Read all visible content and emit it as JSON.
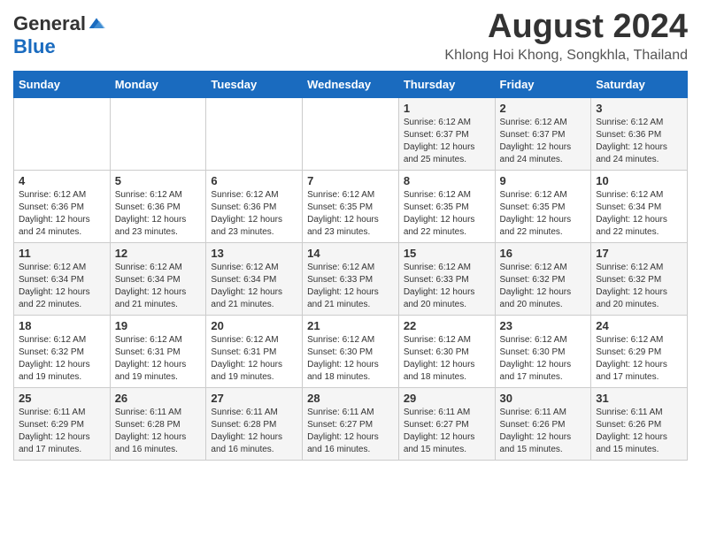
{
  "header": {
    "logo_general": "General",
    "logo_blue": "Blue",
    "month_title": "August 2024",
    "location": "Khlong Hoi Khong, Songkhla, Thailand"
  },
  "days_of_week": [
    "Sunday",
    "Monday",
    "Tuesday",
    "Wednesday",
    "Thursday",
    "Friday",
    "Saturday"
  ],
  "weeks": [
    [
      {
        "day": "",
        "info": ""
      },
      {
        "day": "",
        "info": ""
      },
      {
        "day": "",
        "info": ""
      },
      {
        "day": "",
        "info": ""
      },
      {
        "day": "1",
        "info": "Sunrise: 6:12 AM\nSunset: 6:37 PM\nDaylight: 12 hours\nand 25 minutes."
      },
      {
        "day": "2",
        "info": "Sunrise: 6:12 AM\nSunset: 6:37 PM\nDaylight: 12 hours\nand 24 minutes."
      },
      {
        "day": "3",
        "info": "Sunrise: 6:12 AM\nSunset: 6:36 PM\nDaylight: 12 hours\nand 24 minutes."
      }
    ],
    [
      {
        "day": "4",
        "info": "Sunrise: 6:12 AM\nSunset: 6:36 PM\nDaylight: 12 hours\nand 24 minutes."
      },
      {
        "day": "5",
        "info": "Sunrise: 6:12 AM\nSunset: 6:36 PM\nDaylight: 12 hours\nand 23 minutes."
      },
      {
        "day": "6",
        "info": "Sunrise: 6:12 AM\nSunset: 6:36 PM\nDaylight: 12 hours\nand 23 minutes."
      },
      {
        "day": "7",
        "info": "Sunrise: 6:12 AM\nSunset: 6:35 PM\nDaylight: 12 hours\nand 23 minutes."
      },
      {
        "day": "8",
        "info": "Sunrise: 6:12 AM\nSunset: 6:35 PM\nDaylight: 12 hours\nand 22 minutes."
      },
      {
        "day": "9",
        "info": "Sunrise: 6:12 AM\nSunset: 6:35 PM\nDaylight: 12 hours\nand 22 minutes."
      },
      {
        "day": "10",
        "info": "Sunrise: 6:12 AM\nSunset: 6:34 PM\nDaylight: 12 hours\nand 22 minutes."
      }
    ],
    [
      {
        "day": "11",
        "info": "Sunrise: 6:12 AM\nSunset: 6:34 PM\nDaylight: 12 hours\nand 22 minutes."
      },
      {
        "day": "12",
        "info": "Sunrise: 6:12 AM\nSunset: 6:34 PM\nDaylight: 12 hours\nand 21 minutes."
      },
      {
        "day": "13",
        "info": "Sunrise: 6:12 AM\nSunset: 6:34 PM\nDaylight: 12 hours\nand 21 minutes."
      },
      {
        "day": "14",
        "info": "Sunrise: 6:12 AM\nSunset: 6:33 PM\nDaylight: 12 hours\nand 21 minutes."
      },
      {
        "day": "15",
        "info": "Sunrise: 6:12 AM\nSunset: 6:33 PM\nDaylight: 12 hours\nand 20 minutes."
      },
      {
        "day": "16",
        "info": "Sunrise: 6:12 AM\nSunset: 6:32 PM\nDaylight: 12 hours\nand 20 minutes."
      },
      {
        "day": "17",
        "info": "Sunrise: 6:12 AM\nSunset: 6:32 PM\nDaylight: 12 hours\nand 20 minutes."
      }
    ],
    [
      {
        "day": "18",
        "info": "Sunrise: 6:12 AM\nSunset: 6:32 PM\nDaylight: 12 hours\nand 19 minutes."
      },
      {
        "day": "19",
        "info": "Sunrise: 6:12 AM\nSunset: 6:31 PM\nDaylight: 12 hours\nand 19 minutes."
      },
      {
        "day": "20",
        "info": "Sunrise: 6:12 AM\nSunset: 6:31 PM\nDaylight: 12 hours\nand 19 minutes."
      },
      {
        "day": "21",
        "info": "Sunrise: 6:12 AM\nSunset: 6:30 PM\nDaylight: 12 hours\nand 18 minutes."
      },
      {
        "day": "22",
        "info": "Sunrise: 6:12 AM\nSunset: 6:30 PM\nDaylight: 12 hours\nand 18 minutes."
      },
      {
        "day": "23",
        "info": "Sunrise: 6:12 AM\nSunset: 6:30 PM\nDaylight: 12 hours\nand 17 minutes."
      },
      {
        "day": "24",
        "info": "Sunrise: 6:12 AM\nSunset: 6:29 PM\nDaylight: 12 hours\nand 17 minutes."
      }
    ],
    [
      {
        "day": "25",
        "info": "Sunrise: 6:11 AM\nSunset: 6:29 PM\nDaylight: 12 hours\nand 17 minutes."
      },
      {
        "day": "26",
        "info": "Sunrise: 6:11 AM\nSunset: 6:28 PM\nDaylight: 12 hours\nand 16 minutes."
      },
      {
        "day": "27",
        "info": "Sunrise: 6:11 AM\nSunset: 6:28 PM\nDaylight: 12 hours\nand 16 minutes."
      },
      {
        "day": "28",
        "info": "Sunrise: 6:11 AM\nSunset: 6:27 PM\nDaylight: 12 hours\nand 16 minutes."
      },
      {
        "day": "29",
        "info": "Sunrise: 6:11 AM\nSunset: 6:27 PM\nDaylight: 12 hours\nand 15 minutes."
      },
      {
        "day": "30",
        "info": "Sunrise: 6:11 AM\nSunset: 6:26 PM\nDaylight: 12 hours\nand 15 minutes."
      },
      {
        "day": "31",
        "info": "Sunrise: 6:11 AM\nSunset: 6:26 PM\nDaylight: 12 hours\nand 15 minutes."
      }
    ]
  ]
}
